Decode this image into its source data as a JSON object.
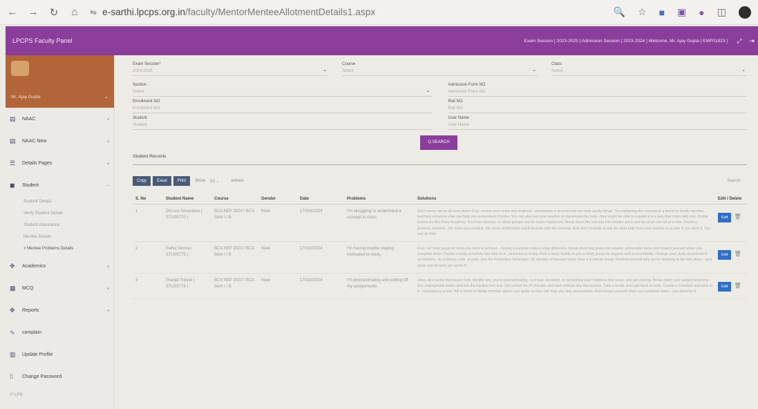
{
  "browser": {
    "url_host": "e-sarthi.lpcps.org.in",
    "url_path": "/faculty/MentorMenteeAllotmentDetails1.aspx"
  },
  "header": {
    "brand": "LPCPS Faculty Panel",
    "info": "Exam Session [ 2023-2025 ]    Admission Session [ 2023-2024 ]    Welcome, Mr. Ajay Gupta [ EMP01823 ]"
  },
  "sidebar": {
    "user_name": "Mr. Ajay Gupta",
    "items": [
      {
        "label": "NAAC",
        "icon": "book-icon",
        "expand": "+"
      },
      {
        "label": "NAAC New",
        "icon": "book-icon",
        "expand": "+"
      },
      {
        "label": "Details Pages",
        "icon": "list-icon",
        "expand": "+"
      },
      {
        "label": "Student",
        "icon": "user-icon",
        "expand": "−"
      }
    ],
    "sub_items": [
      "Student Details",
      "Verify Student Details",
      "Student Attendance",
      "Mentee Details",
      "> Mentee Problems Details"
    ],
    "items2": [
      {
        "label": "Academics",
        "icon": "gear-icon",
        "expand": "+"
      },
      {
        "label": "MCQ",
        "icon": "grid-icon",
        "expand": "+"
      },
      {
        "label": "Reports",
        "icon": "gear-icon",
        "expand": "+"
      },
      {
        "label": "complain",
        "icon": "wave-icon",
        "expand": ""
      },
      {
        "label": "Update Profile",
        "icon": "table-icon",
        "expand": ""
      },
      {
        "label": "Change Password",
        "icon": "key-icon",
        "expand": ""
      }
    ],
    "footer": "© LPS"
  },
  "filters": {
    "exam_session": {
      "label": "Exam Session*",
      "value": "2024-2025"
    },
    "course": {
      "label": "Course",
      "value": "Select"
    },
    "class": {
      "label": "Class",
      "value": "Select"
    },
    "section": {
      "label": "Section",
      "value": "Select"
    },
    "admission_form_no": {
      "label": "Admission Form NO",
      "placeholder": "Admission Form NO"
    },
    "enrollment_no": {
      "label": "Enrollment NO",
      "placeholder": "Enrollment NO"
    },
    "roll_no": {
      "label": "Roll NO",
      "placeholder": "Roll NO"
    },
    "student": {
      "label": "Student",
      "placeholder": "Student"
    },
    "user_name": {
      "label": "User Name",
      "placeholder": "User Name"
    },
    "search_label": "Q SEARCH"
  },
  "records": {
    "title": "Student Records",
    "buttons": [
      "Copy",
      "Excel",
      "Print"
    ],
    "show_label": "Show",
    "show_value": "10",
    "entries_label": "entries",
    "search_label": "Search:",
    "columns": [
      "S. No",
      "Student Name",
      "Course",
      "Gender",
      "Date",
      "Problems",
      "Solutions",
      "Edit / Delete"
    ],
    "edit_label": "Edit",
    "rows": [
      {
        "sno": "1",
        "name": "Dhruva Srivastava ( STU05770 )",
        "course": "BCA NEP 2023 / BCA Sem I / B",
        "gender": "Male",
        "date": "17/Oct/2024",
        "problem": "I'm struggling to understand a concept in class.",
        "solution": "Don't worry, we've all been there! First, review your notes and textbook - sometimes a second look can help clarify things. Try explaining the concept to a friend or family member - teaching someone else can help you understand it better. You can also ask your teacher or classmates for help - they might be able to explain it in a way that clicks with you. Online resources like Khan Academy, YouTube tutorials, or study groups can be super helpful too. Break down the concept into smaller parts and focus on one bit at a time. Practice, practice, practice - the more you practice, the more comfortable you'll become with the concept. And don't hesitate to ask for extra help from your teacher or a tutor if you need it. You can do this!"
      },
      {
        "sno": "2",
        "name": "Rahul Verma ( STU05775 )",
        "course": "BCA NEP 2023 / BCA Sem I / B",
        "gender": "Male",
        "date": "17/Oct/2024",
        "problem": "I'm having trouble staying motivated to study.",
        "solution": "First, set clear goals for what you want to achieve - having a purpose makes a big difference. Break down big goals into smaller, achievable tasks and reward yourself when you complete them. Create a study schedule and stick to it - consistency is key. Find a study buddy or join a study group for support and accountability. Change your study environment sometimes - try a library, cafe, or park. Use the Pomodoro Technique: 25 minutes of focused study, then a 5-minute break. Remind yourself why you're studying in the first place - your goals and dreams are worth it!"
      },
      {
        "sno": "3",
        "name": "Pranjal Trivedi ( STU05776 )",
        "course": "BCA NEP 2023 / BCA Sem I / B",
        "gender": "Male",
        "date": "17/Oct/2024",
        "problem": "I'm procrastinating and putting off my assignments.",
        "solution": "Okay, let's tackle this beast! First, identify why you're procrastinating - is it fear, boredom, or something else? Address that issue, and get moving. Break down your assignments into tiny, manageable tasks, and tick the hardest one first. Set a timer for 25 minutes and work without any distractions. Take a break, then get back to work. Create a schedule and stick to it - consistency is key. Tell a friend or family member about your goals so they can help you stay accountable. And reward yourself when you complete tasks - you deserve it!"
      }
    ]
  }
}
